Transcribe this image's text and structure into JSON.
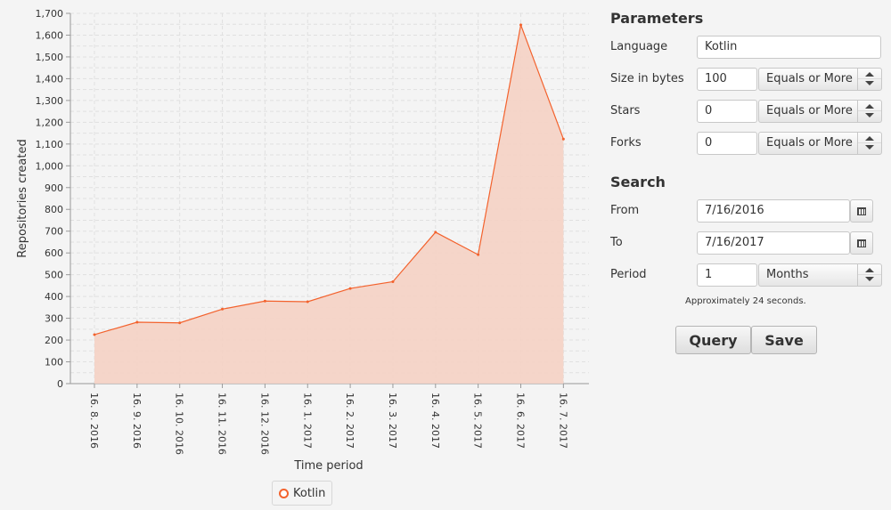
{
  "chart_data": {
    "type": "area",
    "xlabel": "Time period",
    "ylabel": "Repositories created",
    "ylim": [
      0,
      1700
    ],
    "yticks": [
      "0",
      "100",
      "200",
      "300",
      "400",
      "500",
      "600",
      "700",
      "800",
      "900",
      "1,000",
      "1,100",
      "1,200",
      "1,300",
      "1,400",
      "1,500",
      "1,600",
      "1,700"
    ],
    "categories": [
      "16. 8. 2016",
      "16. 9. 2016",
      "16. 10. 2016",
      "16. 11. 2016",
      "16. 12. 2016",
      "16. 1. 2017",
      "16. 2. 2017",
      "16. 3. 2017",
      "16. 4. 2017",
      "16. 5. 2017",
      "16. 6. 2017",
      "16. 7. 2017"
    ],
    "series": [
      {
        "name": "Kotlin",
        "values": [
          225,
          282,
          279,
          342,
          379,
          376,
          437,
          468,
          695,
          592,
          1647,
          1123
        ]
      }
    ],
    "grid": true,
    "legend": "bottom-center",
    "colors": {
      "line": "#f3622d",
      "fill": "#f5d2c4",
      "grid": "#e0e0e0"
    }
  },
  "params": {
    "title": "Parameters",
    "language": {
      "label": "Language",
      "value": "Kotlin"
    },
    "size": {
      "label": "Size in bytes",
      "value": "100",
      "mode": "Equals or More"
    },
    "stars": {
      "label": "Stars",
      "value": "0",
      "mode": "Equals or More"
    },
    "forks": {
      "label": "Forks",
      "value": "0",
      "mode": "Equals or More"
    }
  },
  "search": {
    "title": "Search",
    "from": {
      "label": "From",
      "value": "7/16/2016"
    },
    "to": {
      "label": "To",
      "value": "7/16/2017"
    },
    "period": {
      "label": "Period",
      "value": "1",
      "unit": "Months"
    },
    "hint": "Approximately 24 seconds.",
    "query_label": "Query",
    "save_label": "Save"
  }
}
